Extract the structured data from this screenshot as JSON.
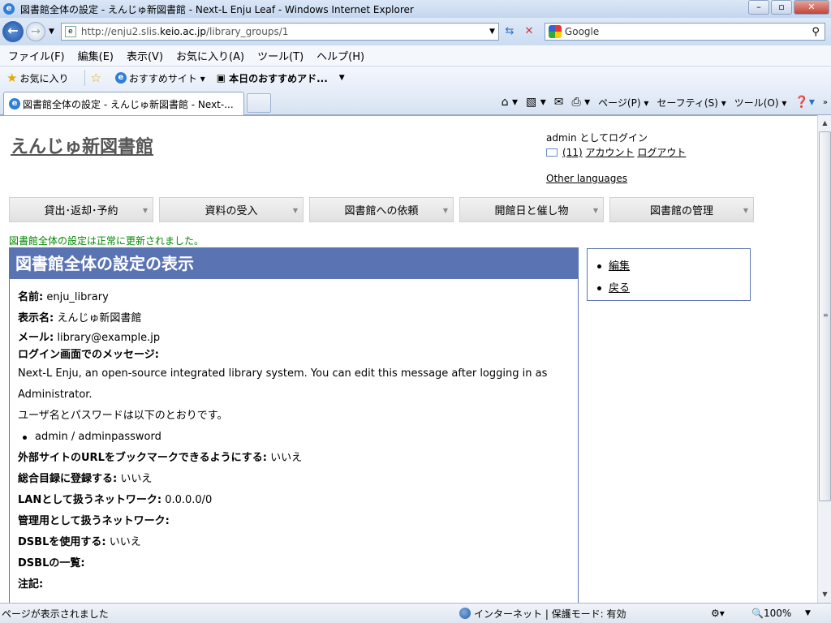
{
  "browser": {
    "title": "図書館全体の設定 - えんじゅ新図書館 - Next-L Enju Leaf - Windows Internet Explorer",
    "url_prefix": "http://enju2.slis.",
    "url_domain": "keio.ac.jp",
    "url_suffix": "/library_groups/1",
    "search_placeholder": "Google",
    "menu": [
      "ファイル(F)",
      "編集(E)",
      "表示(V)",
      "お気に入り(A)",
      "ツール(T)",
      "ヘルプ(H)"
    ],
    "favorites": {
      "label": "お気に入り",
      "items": [
        "おすすめサイト ▾",
        "本日のおすすめアド..."
      ]
    },
    "tab_title": "図書館全体の設定 - えんじゅ新図書館 - Next-...",
    "command_bar": [
      "ページ(P) ▾",
      "セーフティ(S) ▾",
      "ツール(O) ▾"
    ],
    "status_text": "ページが表示されました",
    "zone_text": "インターネット | 保護モード: 有効",
    "zoom": "100%"
  },
  "site": {
    "title": "えんじゅ新図書館",
    "login_text": "admin としてログイン",
    "messages_count": "(11)",
    "account_link": "アカウント",
    "logout_link": "ログアウト",
    "other_languages": "Other languages"
  },
  "nav": [
    {
      "label": "貸出･返却･予約"
    },
    {
      "label": "資料の受入"
    },
    {
      "label": "図書館への依頼"
    },
    {
      "label": "開館日と催し物"
    },
    {
      "label": "図書館の管理"
    }
  ],
  "notice": "図書館全体の設定は正常に更新されました。",
  "main": {
    "heading": "図書館全体の設定の表示",
    "name_label": "名前:",
    "name_value": "enju_library",
    "display_name_label": "表示名:",
    "display_name_value": "えんじゅ新図書館",
    "email_label": "メール:",
    "email_value": "library@example.jp",
    "login_message_label": "ログイン画面でのメッセージ:",
    "login_message_line1": "Next-L Enju, an open-source integrated library system. You can edit this message after logging in as",
    "login_message_line2": "Administrator.",
    "login_message_line3": "ユーザ名とパスワードは以下のとおりです。",
    "login_message_bullet": "admin / adminpassword",
    "bookmark_label": "外部サイトのURLをブックマークできるようにする:",
    "bookmark_value": "いいえ",
    "union_catalog_label": "総合目録に登録する:",
    "union_catalog_value": "いいえ",
    "lan_label": "LANとして扱うネットワーク:",
    "lan_value": "0.0.0.0/0",
    "admin_network_label": "管理用として扱うネットワーク:",
    "dsbl_label": "DSBLを使用する:",
    "dsbl_value": "いいえ",
    "dsbl_list_label": "DSBLの一覧:",
    "note_label": "注記:"
  },
  "sidebar": {
    "edit": "編集",
    "back": "戻る"
  }
}
